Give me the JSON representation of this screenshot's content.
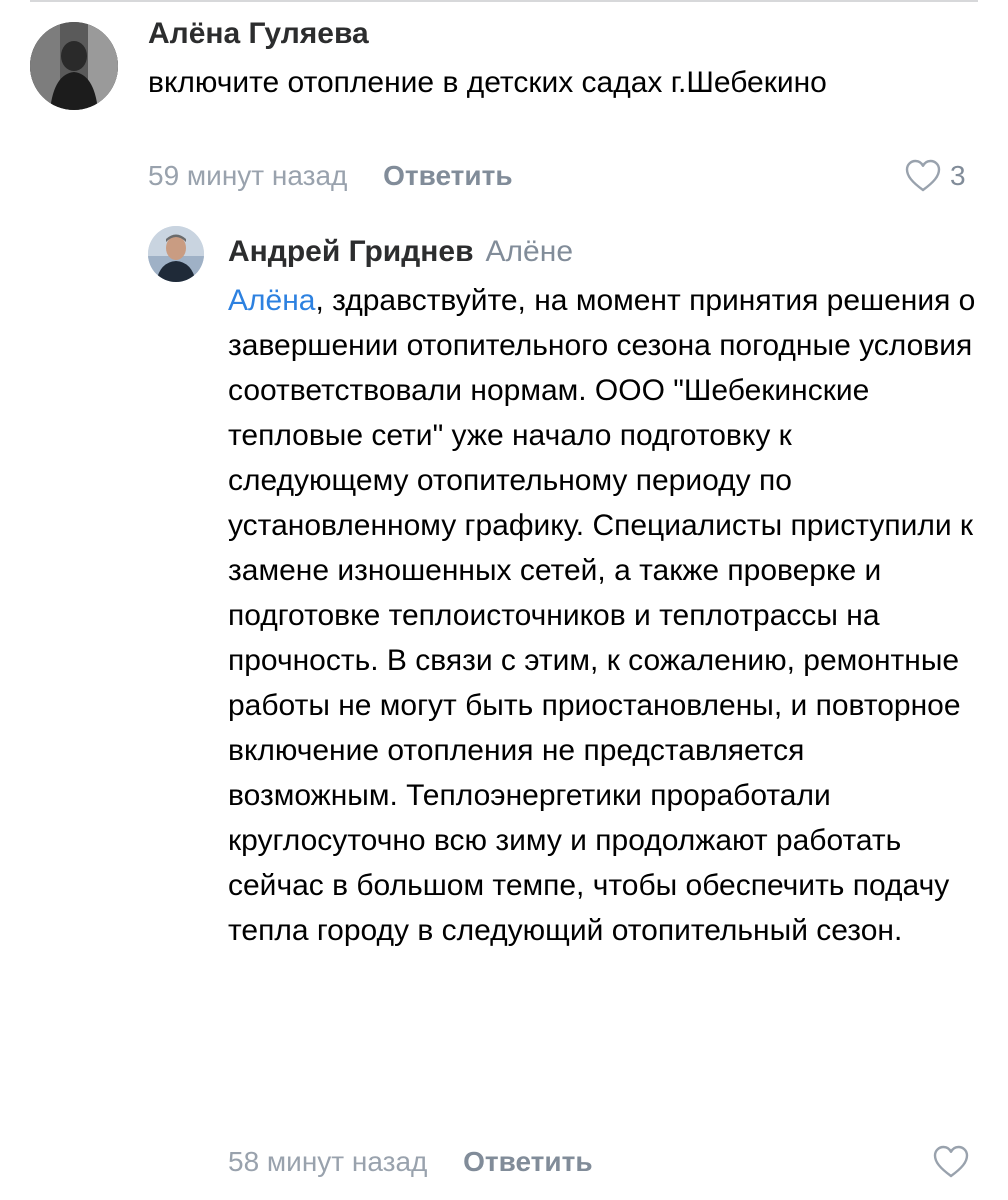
{
  "comments": [
    {
      "author": "Алёна Гуляева",
      "text": "включите отопление в детских садах г.Шебекино",
      "time": "59 минут назад",
      "reply_label": "Ответить",
      "likes": "3"
    }
  ],
  "reply": {
    "author": "Андрей Гриднев",
    "reply_to": "Алёне",
    "mention": "Алёна",
    "text": ", здравствуйте, на момент принятия решения о завершении отопительного сезона погодные условия соответствовали нормам. ООО \"Шебекинские тепловые сети\" уже начало подготовку к следующему отопительному периоду по установленному графику. Специалисты приступили к замене изношенных сетей, а также проверке и подготовке теплоисточников и теплотрассы на прочность. В связи с этим, к сожалению, ремонтные работы не могут быть приостановлены, и повторное включение отопления не представляется возможным. Теплоэнергетики проработали круглосуточно всю зиму и продолжают работать сейчас в большом темпе, чтобы обеспечить подачу тепла городу в следующий отопительный сезон.",
    "time": "58 минут назад",
    "reply_label": "Ответить"
  },
  "icons": {
    "like": "heart-outline-icon"
  },
  "colors": {
    "mention": "#2d81e0",
    "secondary_text": "#818c99",
    "time_text": "#99a2ad"
  }
}
